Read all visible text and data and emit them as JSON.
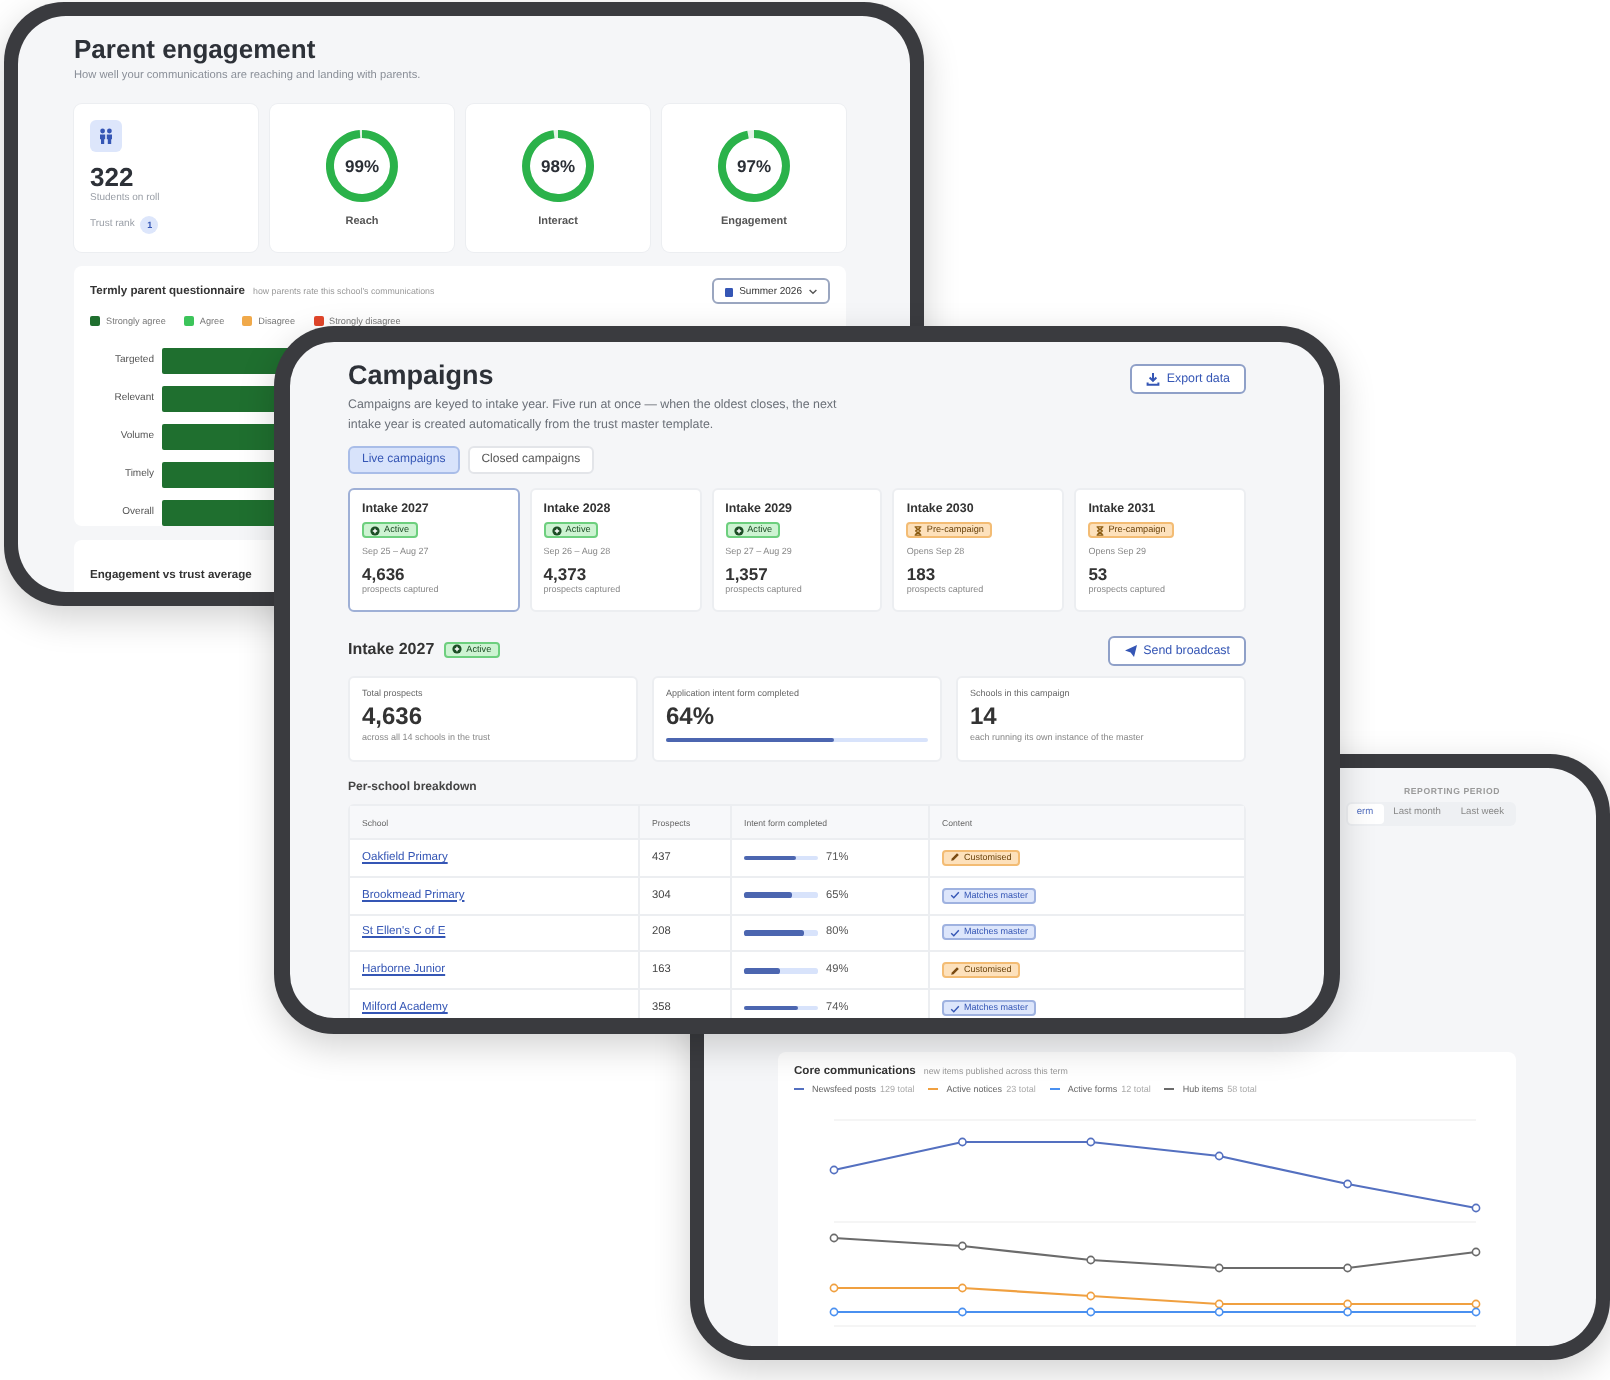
{
  "engagement": {
    "title": "Parent engagement",
    "subtitle": "How well your communications are reaching and landing with parents.",
    "students": {
      "count": "322",
      "label": "Students on roll",
      "rank_label": "Trust rank",
      "rank": "1"
    },
    "rings": [
      {
        "value": "99%",
        "label": "Reach",
        "level": 0.99
      },
      {
        "value": "98%",
        "label": "Interact",
        "level": 0.98
      },
      {
        "value": "97%",
        "label": "Engagement",
        "level": 0.97
      }
    ],
    "questionnaire": {
      "title": "Termly parent questionnaire",
      "subtitle": "how parents rate this school's communications",
      "period": "Summer 2026",
      "legend": [
        {
          "label": "Strongly agree",
          "color": "#1f6f2f"
        },
        {
          "label": "Agree",
          "color": "#3cc45a"
        },
        {
          "label": "Disagree",
          "color": "#f0a94a"
        },
        {
          "label": "Strongly disagree",
          "color": "#e2462a"
        }
      ],
      "rows": [
        "Targeted",
        "Relevant",
        "Volume",
        "Timely",
        "Overall"
      ]
    },
    "comparison": {
      "title": "Engagement vs trust average"
    }
  },
  "campaigns": {
    "title": "Campaigns",
    "description": "Campaigns are keyed to intake year. Five run at once — when the oldest closes, the next intake year is created automatically from the trust master template.",
    "export": "Export data",
    "tabs": [
      {
        "label": "Live campaigns",
        "selected": true
      },
      {
        "label": "Closed campaigns",
        "selected": false
      }
    ],
    "intakes": [
      {
        "name": "Intake 2027",
        "kind": "active",
        "status": "Active",
        "dates": "Sep 25 – Aug 27",
        "count": "4,636",
        "caption": "prospects captured",
        "selected": true
      },
      {
        "name": "Intake 2028",
        "kind": "active",
        "status": "Active",
        "dates": "Sep 26 – Aug 28",
        "count": "4,373",
        "caption": "prospects captured",
        "selected": false
      },
      {
        "name": "Intake 2029",
        "kind": "active",
        "status": "Active",
        "dates": "Sep 27 – Aug 29",
        "count": "1,357",
        "caption": "prospects captured",
        "selected": false
      },
      {
        "name": "Intake 2030",
        "kind": "pre",
        "status": "Pre-campaign",
        "dates": "Opens Sep 28",
        "count": "183",
        "caption": "prospects captured",
        "selected": false
      },
      {
        "name": "Intake 2031",
        "kind": "pre",
        "status": "Pre-campaign",
        "dates": "Opens Sep 29",
        "count": "53",
        "caption": "prospects captured",
        "selected": false
      }
    ],
    "detail": {
      "title": "Intake 2027",
      "kind": "active",
      "status": "Active",
      "broadcast": "Send broadcast",
      "stats": [
        {
          "label": "Total prospects",
          "value": "4,636",
          "note": "across all 14 schools in the trust"
        },
        {
          "label": "Application intent form completed",
          "value": "64%",
          "level": 0.64
        },
        {
          "label": "Schools in this campaign",
          "value": "14",
          "note": "each running its own instance of the master"
        }
      ],
      "breakdown_title": "Per-school breakdown",
      "columns": [
        "School",
        "Prospects",
        "Intent form completed",
        "Content"
      ],
      "rows": [
        {
          "school": "Oakfield Primary",
          "prospects": "437",
          "level": 0.71,
          "percent": "71%",
          "kind": "customised",
          "content": "Customised"
        },
        {
          "school": "Brookmead Primary",
          "prospects": "304",
          "level": 0.65,
          "percent": "65%",
          "kind": "master",
          "content": "Matches master"
        },
        {
          "school": "St Ellen's C of E",
          "prospects": "208",
          "level": 0.8,
          "percent": "80%",
          "kind": "master",
          "content": "Matches master"
        },
        {
          "school": "Harborne Junior",
          "prospects": "163",
          "level": 0.49,
          "percent": "49%",
          "kind": "customised",
          "content": "Customised"
        },
        {
          "school": "Milford Academy",
          "prospects": "358",
          "level": 0.74,
          "percent": "74%",
          "kind": "master",
          "content": "Matches master"
        }
      ]
    }
  },
  "reports": {
    "period_label": "REPORTING PERIOD",
    "periods": [
      {
        "label": "erm",
        "selected": true
      },
      {
        "label": "Last month",
        "selected": false
      },
      {
        "label": "Last week",
        "selected": false
      }
    ],
    "chart": {
      "title": "Core communications",
      "subtitle": "new items published across this term",
      "legend": [
        {
          "label": "Newsfeed posts",
          "total": "129 total",
          "color": "#5470c0"
        },
        {
          "label": "Active notices",
          "total": "23 total",
          "color": "#f0a040"
        },
        {
          "label": "Active forms",
          "total": "12 total",
          "color": "#4a90f0"
        },
        {
          "label": "Hub items",
          "total": "58 total",
          "color": "#6b6b6b"
        }
      ]
    }
  }
}
